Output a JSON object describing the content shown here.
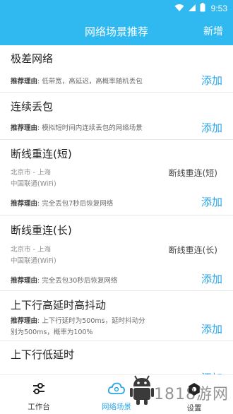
{
  "status_bar": {
    "time": "9:53",
    "icons": [
      "wifi-icon",
      "signal-icon",
      "battery-icon"
    ]
  },
  "header": {
    "title": "网络场景推荐",
    "add_label": "新增"
  },
  "scenarios": [
    {
      "title": "极差网络",
      "reason_label": "推荐理由",
      "reason_text": ": 低带宽，高延迟，高概率随机丢包",
      "add_label": "添加"
    },
    {
      "title": "连续丢包",
      "reason_label": "推荐理由",
      "reason_text": ": 模拟短时间内连续丢包的网络场景",
      "add_label": "添加"
    },
    {
      "title": "断线重连(短)",
      "location": "北京市 - 上海",
      "carrier": "中国联通(WiFi)",
      "status": "断线重连(短)",
      "reason_label": "推荐理由",
      "reason_text": ": 完全丢包7秒后恢复网络",
      "add_label": "添加"
    },
    {
      "title": "断线重连(长)",
      "location": "北京市 - 上海",
      "carrier": "中国联通(WiFi)",
      "status": "断线重连(长)",
      "reason_label": "推荐理由",
      "reason_text": ": 完全丢包30秒后恢复网络",
      "add_label": "添加"
    },
    {
      "title": "上下行高延时高抖动",
      "reason_label": "推荐理由",
      "reason_text_line1": ": 上下行延时为500ms，延时抖动分",
      "reason_text_line2": "别为500ms，概率为100%",
      "add_label": "添加"
    },
    {
      "title": "上下行低延时",
      "add_label": "添加"
    }
  ],
  "bottom_nav": [
    {
      "label": "工作台",
      "icon": "sliders-icon",
      "active": false
    },
    {
      "label": "网络场景",
      "icon": "cloud-icon",
      "active": true
    },
    {
      "label": "设置",
      "icon": "gear-icon",
      "active": false
    }
  ],
  "watermark": {
    "text": "1818游网",
    "icon": "android-robot-icon"
  },
  "colors": {
    "primary": "#2fb9f0",
    "accent_text": "#2aa6e6",
    "divider": "#e6e6e6"
  }
}
